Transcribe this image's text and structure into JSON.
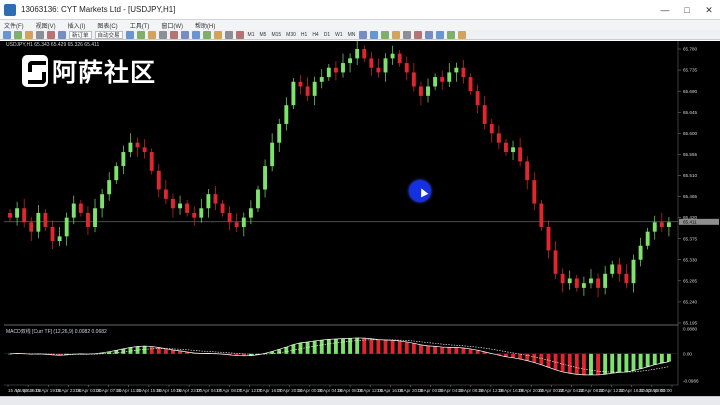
{
  "window": {
    "title": "13063136: CYT Markets Ltd - [USDJPY,H1]",
    "controls": [
      "minimize",
      "maximize",
      "close"
    ]
  },
  "menu": {
    "items": [
      "文件(F)",
      "视图(V)",
      "插入(I)",
      "图表(C)",
      "工具(T)",
      "窗口(W)",
      "帮助(H)"
    ]
  },
  "toolbar": {
    "new_order_label": "新订单",
    "algo_trading_label": "自动交易",
    "timeframes": [
      "M1",
      "M5",
      "M15",
      "M30",
      "H1",
      "H4",
      "D1",
      "W1",
      "MN"
    ],
    "icons": [
      "new-chart-icon",
      "profiles-icon",
      "market-watch-icon",
      "navigator-icon",
      "terminal-icon",
      "strategy-tester-icon",
      "bar-chart-icon",
      "candle-chart-icon",
      "line-chart-icon",
      "zoom-in-icon",
      "zoom-out-icon",
      "tile-icon",
      "autoscroll-icon",
      "chart-shift-icon",
      "indicators-icon",
      "periods-icon",
      "templates-icon",
      "cursor-icon",
      "crosshair-icon",
      "vertical-line-icon",
      "horizontal-line-icon",
      "trendline-icon",
      "channel-icon",
      "fibonacci-icon",
      "text-icon",
      "label-icon",
      "arrows-icon"
    ]
  },
  "chart": {
    "symbol_label": "USDJPY,H1 65.343 65.429 65.326 65.411",
    "macd_label": "MACD双线 [Curr TF] (12,26,9) 0.0082 0.0682",
    "logo_text": "阿萨社区",
    "colors": {
      "background": "#000000",
      "bull": "#7ee36b",
      "bear": "#e0262e",
      "grid": "#2a2a2a",
      "price_line": "#9a9a9a"
    }
  },
  "chart_data": {
    "type": "candlestick",
    "price_axis_ticks": [
      "65.780",
      "65.735",
      "65.690",
      "65.645",
      "65.600",
      "65.555",
      "65.510",
      "65.465",
      "65.420",
      "65.375",
      "65.330",
      "65.285",
      "65.240",
      "65.195"
    ],
    "current_price": "65.411",
    "macd_axis_ticks": [
      "0.0880",
      "0.00",
      "-0.0966"
    ],
    "time_axis_ticks": [
      "15 Apr 2019",
      "15 Apr 15:00",
      "15 Apr 19:00",
      "15 Apr 23:00",
      "16 Apr 03:00",
      "16 Apr 07:00",
      "16 Apr 11:00",
      "16 Apr 15:00",
      "16 Apr 19:00",
      "16 Apr 23:00",
      "17 Apr 04:00",
      "17 Apr 08:00",
      "17 Apr 12:00",
      "17 Apr 16:00",
      "17 Apr 20:00",
      "18 Apr 00:00",
      "18 Apr 04:00",
      "18 Apr 08:00",
      "18 Apr 12:00",
      "18 Apr 16:00",
      "18 Apr 20:00",
      "19 Apr 00:00",
      "19 Apr 04:00",
      "19 Apr 08:00",
      "19 Apr 12:00",
      "19 Apr 16:00",
      "19 Apr 20:00",
      "22 Apr 00:00",
      "22 Apr 04:00",
      "22 Apr 08:00",
      "22 Apr 12:00",
      "22 Apr 16:00",
      "22 Apr 20:00",
      "23 Apr 00:00"
    ],
    "closes": [
      65.42,
      65.44,
      65.41,
      65.39,
      65.43,
      65.4,
      65.37,
      65.38,
      65.42,
      65.45,
      65.43,
      65.4,
      65.44,
      65.47,
      65.5,
      65.53,
      65.56,
      65.58,
      65.57,
      65.56,
      65.52,
      65.48,
      65.46,
      65.44,
      65.45,
      65.43,
      65.42,
      65.44,
      65.47,
      65.45,
      65.43,
      65.41,
      65.4,
      65.42,
      65.44,
      65.48,
      65.53,
      65.58,
      65.62,
      65.66,
      65.71,
      65.7,
      65.68,
      65.71,
      65.72,
      65.74,
      65.73,
      65.75,
      65.76,
      65.78,
      65.76,
      65.74,
      65.73,
      65.76,
      65.77,
      65.75,
      65.73,
      65.7,
      65.68,
      65.7,
      65.72,
      65.71,
      65.73,
      65.74,
      65.72,
      65.69,
      65.66,
      65.62,
      65.6,
      65.58,
      65.56,
      65.57,
      65.54,
      65.5,
      65.45,
      65.4,
      65.35,
      65.3,
      65.28,
      65.29,
      65.27,
      65.28,
      65.29,
      65.27,
      65.3,
      65.32,
      65.3,
      65.28,
      65.33,
      65.36,
      65.39,
      65.41,
      65.4,
      65.41
    ]
  }
}
